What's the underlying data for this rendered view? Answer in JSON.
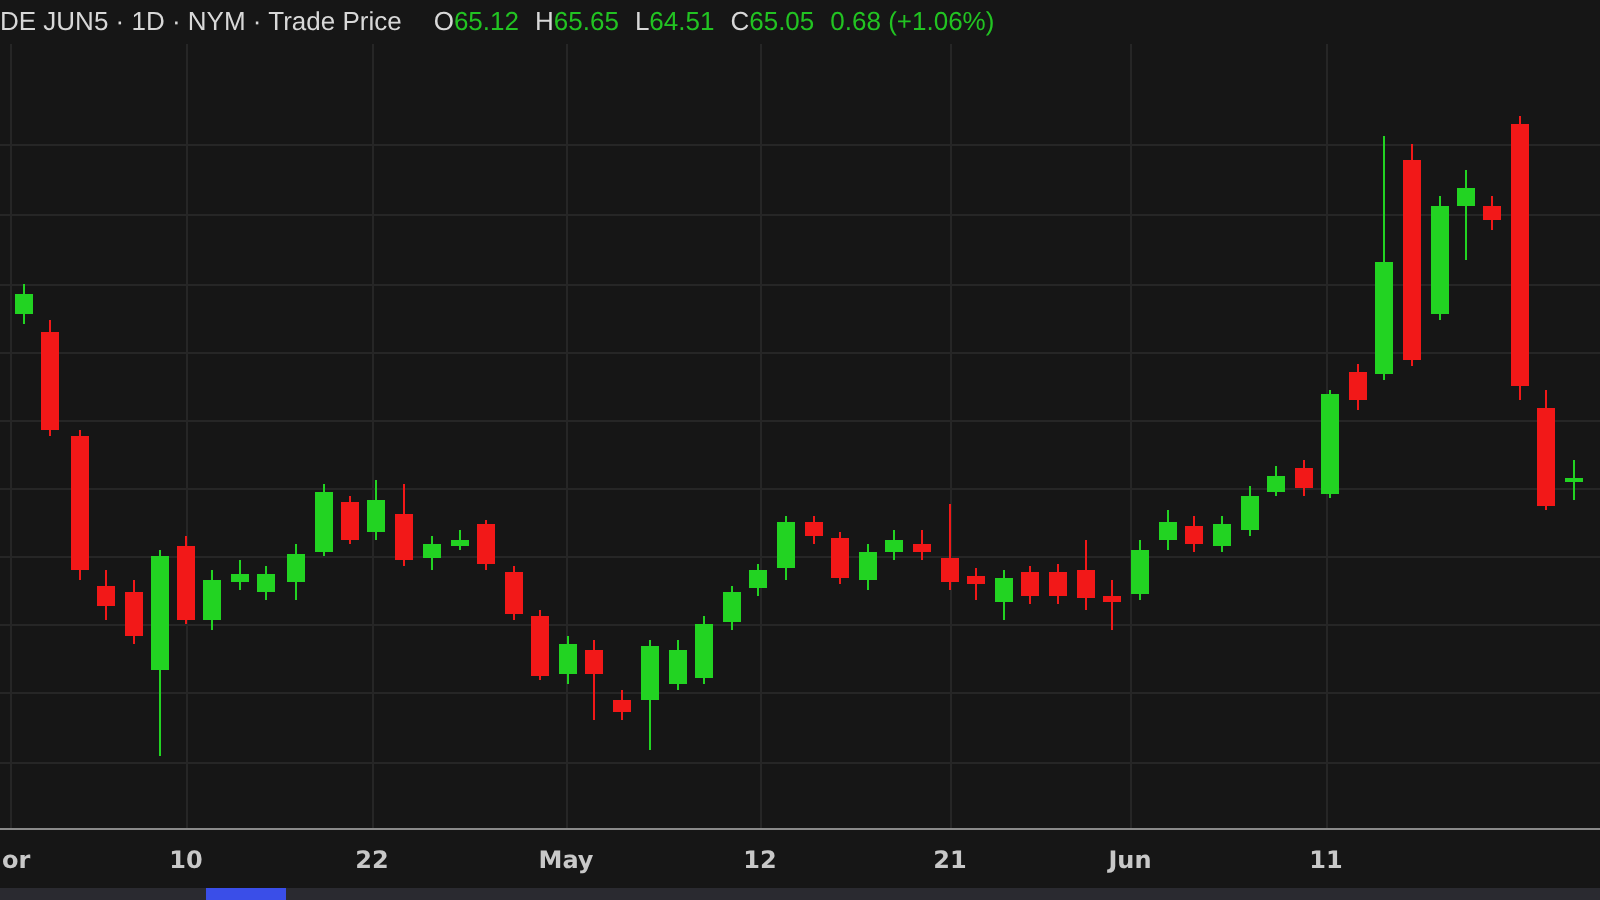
{
  "header": {
    "title": "DE JUN5 · 1D · NYM · Trade Price",
    "quotes": [
      {
        "label": "O",
        "value": "65.12"
      },
      {
        "label": "H",
        "value": "65.65"
      },
      {
        "label": "L",
        "value": "64.51"
      },
      {
        "label": "C",
        "value": "65.05"
      }
    ],
    "change": "0.68 (+1.06%)"
  },
  "x_axis": {
    "labels": [
      "or",
      "10",
      "22",
      "May",
      "12",
      "21",
      "Jun",
      "11"
    ]
  }
}
